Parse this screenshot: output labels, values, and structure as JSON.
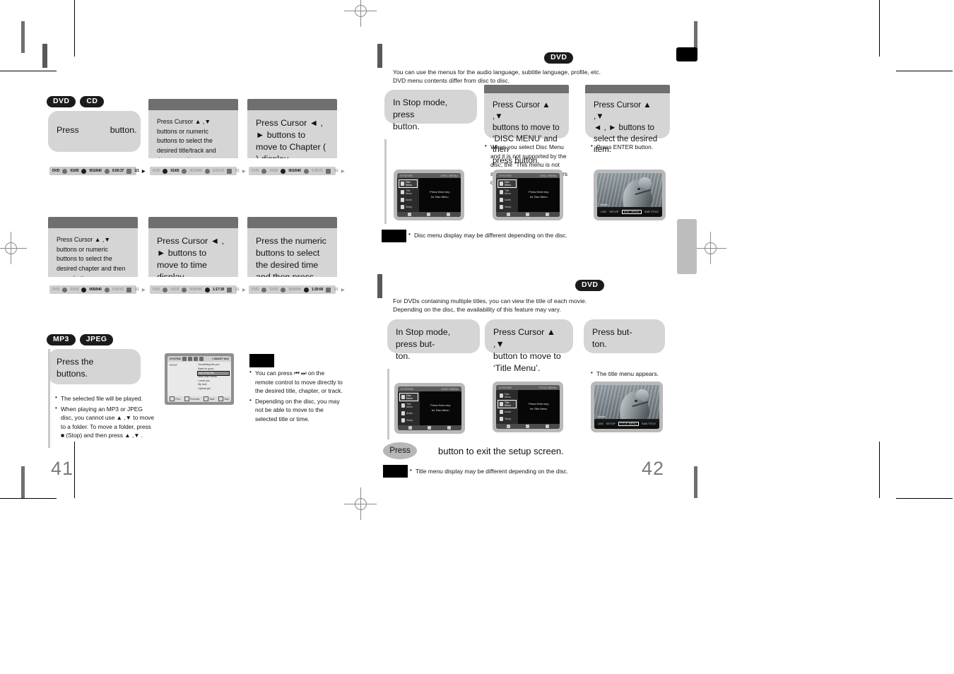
{
  "document": {
    "left_page_number": "41",
    "right_page_number": "42"
  },
  "left_page": {
    "section_a": {
      "badges": [
        "DVD",
        "CD"
      ],
      "steps": [
        {
          "text_before": "Press",
          "text_after": "button.",
          "osd": {
            "disc": "DVD",
            "title": "01/05",
            "chapter": "001/040",
            "time": "0:00:37",
            "audio": "1/1",
            "play": "▶",
            "highlight": "title"
          }
        },
        {
          "text": "Press Cursor ▲ ,▼ buttons or numeric buttons to select the desired title/track and then press        button.",
          "osd": {
            "disc": "DVD",
            "title": "01/05",
            "chapter": "001/040",
            "time": "0:00:01",
            "audio": "1/1",
            "play": "▶",
            "highlight": "title"
          }
        },
        {
          "text": "Press Cursor ◄ , ► buttons to move to Chapter (       ) display.",
          "osd": {
            "disc": "DVD",
            "title": "01/05",
            "chapter": "001/040",
            "time": "0:00:01",
            "audio": "1/1",
            "play": "▶",
            "highlight": "chapter"
          }
        },
        {
          "text": "Press Cursor ▲ ,▼ buttons or numeric buttons to select the desired chapter and then press        button.",
          "osd": {
            "disc": "DVD",
            "title": "01/05",
            "chapter": "005/040",
            "time": "0:00:01",
            "audio": "1/1",
            "play": "▶",
            "highlight": "chapter"
          }
        },
        {
          "text": "Press Cursor ◄ , ► buttons to move to time display.",
          "osd": {
            "disc": "DVD",
            "title": "01/05",
            "chapter": "005/040",
            "time": "1:17:30",
            "audio": "1/1",
            "play": "▶",
            "highlight": "time"
          }
        },
        {
          "text": "Press the numeric buttons to select the desired time and then press        button.",
          "osd": {
            "disc": "DVD",
            "title": "01/05",
            "chapter": "005/040",
            "time": "1:30:00",
            "audio": "1/1",
            "play": "▶",
            "highlight": "time"
          }
        }
      ]
    },
    "section_b": {
      "badges": [
        "MP3",
        "JPEG"
      ],
      "step_text_line1": "Press the",
      "step_text_line2": "buttons.",
      "notes": [
        "The selected file will be played.",
        "When playing an MP3 or JPEG disc, you cannot use ▲ ,▼ to move to a folder. To move a folder, press ■ (Stop) and then press ▲ ,▼ ."
      ],
      "mp3_screen": {
        "toolbar_title": "SYSTEM",
        "toolbar_right": "♦ SMART NAV",
        "folder": "ROOT",
        "tracks": [
          "Something like you",
          "Back for good",
          "One of the file",
          "More than words",
          "I need you",
          "My love",
          "Upbeat girl"
        ],
        "selected_track_index": 2,
        "footer": [
          "Prev",
          "Previous",
          "Next",
          "Stop"
        ]
      },
      "note_box": {
        "items": [
          "You can press ⏮ ⏭ on the remote control to move directly to the desired title, chapter, or track.",
          "Depending on the disc, you may not be able to move to the selected title or time."
        ]
      }
    }
  },
  "right_page": {
    "section_disc_menu": {
      "badge": "DVD",
      "intro_line1": "You can use the menus for the audio language, subtitle language, profile, etc.",
      "intro_line2": "DVD menu contents differ from disc to disc.",
      "steps": [
        {
          "lines": [
            "In Stop mode,",
            "press",
            "button."
          ],
          "notes": [],
          "screen": "disc-menu"
        },
        {
          "lines": [
            "Press Cursor ▲ ,▼",
            "buttons to move to",
            "‘DISC MENU’ and then",
            "press          button."
          ],
          "notes": [
            "When you select Disc Menu and it is not supported by the disc, the \"This menu is not supported\" message appears on the screen."
          ],
          "screen": "disc-menu"
        },
        {
          "lines": [
            "Press Cursor ▲ ,▼",
            "◄ , ► buttons to",
            "select the desired",
            "item."
          ],
          "notes": [
            "Press ENTER button."
          ],
          "screen": "dolphin"
        }
      ],
      "footer_note": "Disc menu display may be different depending on the disc."
    },
    "section_title_menu": {
      "badge": "DVD",
      "intro_line1": "For DVDs containing multiple titles, you can view the title of each movie.",
      "intro_line2": "Depending on the disc, the availability of this feature may vary.",
      "steps": [
        {
          "lines": [
            "In Stop mode,",
            "press          but-",
            "ton."
          ],
          "notes": [],
          "screen": "disc-menu"
        },
        {
          "lines": [
            "Press Cursor ▲ ,▼",
            "button to move to",
            "‘Title Menu’."
          ],
          "notes": [],
          "screen": "title-menu"
        },
        {
          "lines": [
            "Press            but-",
            "ton."
          ],
          "notes": [
            "The title menu appears."
          ],
          "screen": "dolphin"
        }
      ],
      "exit_chip": "Press",
      "exit_line": "button to exit the setup screen.",
      "footer_note": "Title menu display may be different depending on the disc."
    },
    "osd_menu_screens": {
      "disc_menu": {
        "topbar_left": "SYSTEM",
        "topbar_right": "DISC MENU",
        "items": [
          "Disc Menu",
          "Title Menu",
          "Audio",
          "Setup"
        ],
        "selected_item_index": 0,
        "message_line1": "Press Enter key",
        "message_line2": "for Disc Menu"
      },
      "title_menu": {
        "topbar_left": "SYSTEM",
        "topbar_right": "TITLE MENU",
        "items": [
          "Disc Menu",
          "Title Menu",
          "Audio",
          "Setup"
        ],
        "selected_item_index": 1,
        "message_line1": "Press Enter key",
        "message_line2": "for Title Menu"
      },
      "dolphin_osd": {
        "tag": "Dolphin",
        "buttons": [
          "LNG",
          "SETUP",
          "DISC MENU",
          "SUB TITLE"
        ],
        "selected_button_index": 2,
        "buttons_alt": [
          "LNG",
          "SETUP",
          "TITLE MENU",
          "SUB TITLE"
        ],
        "selected_button_alt_index": 2
      }
    }
  },
  "colors": {
    "bubble": "#d5d5d5",
    "cap": "#6f6f6f",
    "badge": "#1b1b1b",
    "page_number": "#7a7a7a",
    "section_bar": "#595959"
  }
}
